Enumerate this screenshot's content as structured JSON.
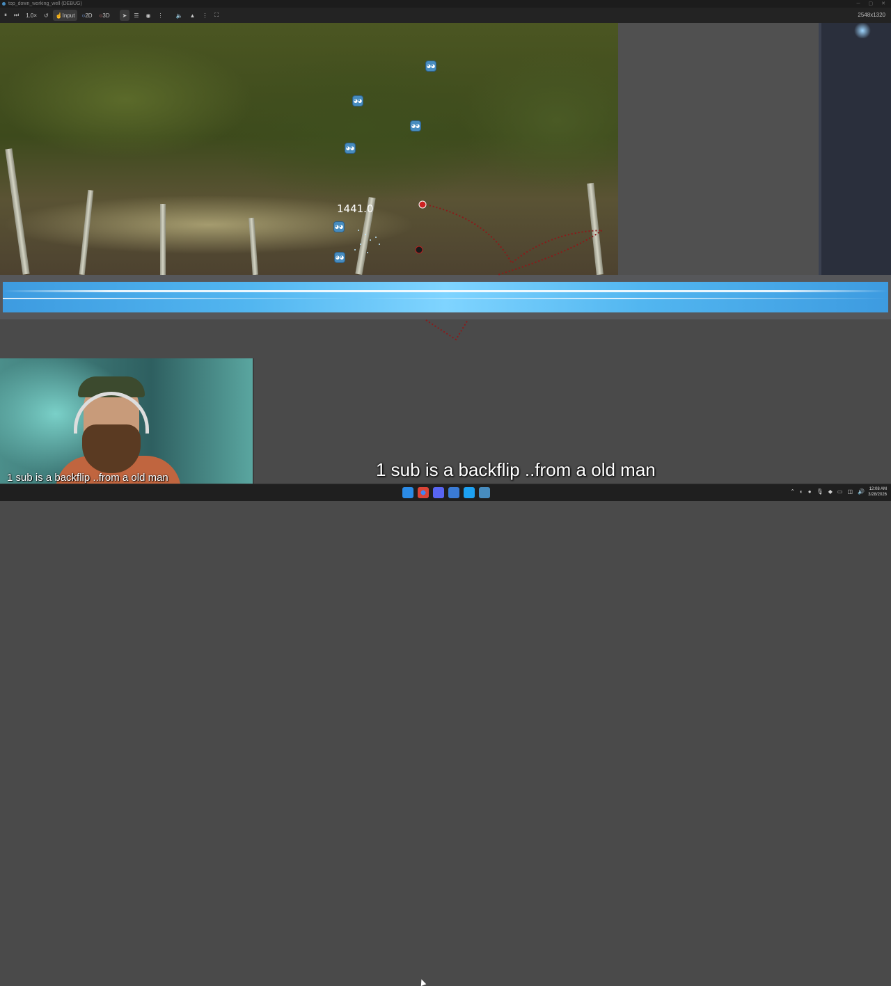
{
  "window": {
    "title": "top_down_working_well (DEBUG)"
  },
  "toolbar": {
    "zoom": "1.0×",
    "input_label": "Input",
    "mode_2d": "2D",
    "mode_3d": "3D",
    "resolution": "2548x1320"
  },
  "game": {
    "value_label": "1441.0",
    "icons": [
      "godot-icon",
      "godot-icon",
      "godot-icon",
      "godot-icon",
      "godot-icon",
      "godot-icon"
    ]
  },
  "captions": {
    "overlay": "1 sub is a backflip ..from a old man",
    "webcam": "1 sub is a backflip ..from a old man"
  },
  "taskbar": {
    "time": "12:08 AM",
    "date": "3/28/2026"
  },
  "colors": {
    "accent": "#478cbf",
    "track": "#52b6f0",
    "path": "#8b1a1a"
  }
}
